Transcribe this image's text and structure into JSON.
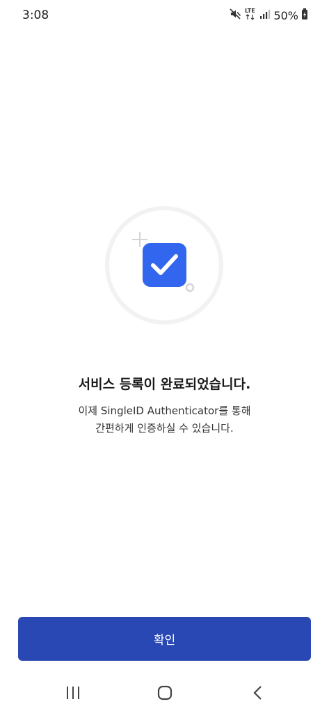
{
  "status_bar": {
    "time": "3:08",
    "network": "LTE",
    "battery": "50%",
    "icons": [
      "mute-icon",
      "lte-icon",
      "signal-icon",
      "battery-charging-icon"
    ]
  },
  "illustration": {
    "icon": "check-icon",
    "accent_color": "#3366ee"
  },
  "main": {
    "title": "서비스 등록이 완료되었습니다.",
    "description_line1": "이제 SingleID Authenticator를 통해",
    "description_line2": "간편하게 인증하실 수 있습니다."
  },
  "confirm_button": {
    "label": "확인",
    "color": "#2948b3"
  },
  "nav_bar": {
    "icons": [
      "recent-apps-icon",
      "home-icon",
      "back-icon"
    ]
  }
}
